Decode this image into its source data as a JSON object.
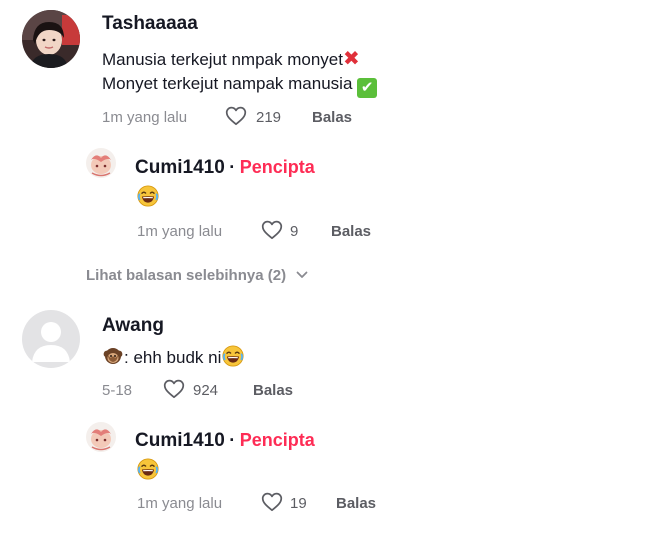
{
  "comments": [
    {
      "author": "Tashaaaaa",
      "line1": "Manusia terkejut nmpak monyet",
      "line1_mark": "✖",
      "line2": "Monyet terkejut nampak manusia",
      "line2_mark": "✔",
      "time": "1m yang lalu",
      "likes": "219",
      "reply_label": "Balas",
      "replies": [
        {
          "author": "Cumi1410",
          "sep": "·",
          "badge": "Pencipta",
          "text_emoji": "face-with-tears-of-joy",
          "time": "1m yang lalu",
          "likes": "9",
          "reply_label": "Balas"
        }
      ],
      "more_replies": "Lihat balasan selebihnya (2)"
    },
    {
      "author": "Awang",
      "text_emoji": "monkey",
      "text": ": ehh budk ni",
      "time": "5-18",
      "likes": "924",
      "reply_label": "Balas",
      "replies": [
        {
          "author": "Cumi1410",
          "sep": "·",
          "badge": "Pencipta",
          "text_emoji": "face-with-tears-of-joy",
          "time": "1m yang lalu",
          "likes": "19",
          "reply_label": "Balas"
        }
      ]
    }
  ],
  "colors": {
    "creator_badge": "#fe2c55",
    "meta_text": "#8a8b91",
    "check_green": "#5bbf3a",
    "cross_red": "#e0303a"
  }
}
